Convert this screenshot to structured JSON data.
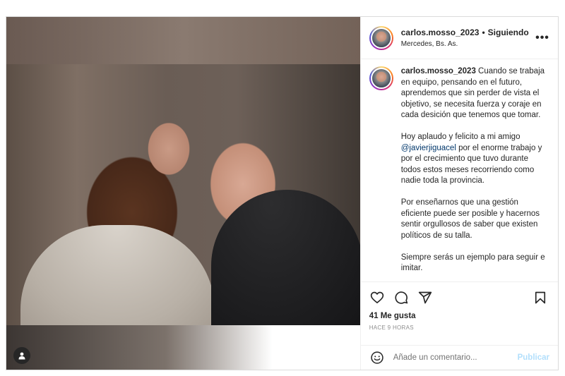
{
  "post": {
    "username": "carlos.mosso_2023",
    "separator": "•",
    "follow_status": "Siguiendo",
    "location": "Mercedes, Bs. As.",
    "more_label": "•••"
  },
  "caption": {
    "username": "carlos.mosso_2023",
    "p1": "Cuando se trabaja en equipo, pensando en el futuro, aprendemos que sin perder de vista el objetivo, se necesita fuerza y coraje en cada desición que tenemos que tomar.",
    "p2_before": "Hoy aplaudo y felicito a mi amigo ",
    "p2_mention": "@javierjiguacel",
    "p2_after": " por el enorme trabajo y por el crecimiento que tuvo durante todos estos meses recorriendo como nadie toda la provincia.",
    "p3": "Por enseñarnos que una gestión eficiente puede ser posible y hacernos sentir orgullosos de saber que existen políticos de su talla.",
    "p4": "Siempre serás un ejemplo para seguir e imitar."
  },
  "engagement": {
    "likes": "41 Me gusta",
    "time": "HACE 9 HORAS"
  },
  "comment": {
    "placeholder": "Añade un comentario...",
    "publish_label": "Publicar"
  },
  "icons": [
    "heart-icon",
    "comment-icon",
    "share-icon",
    "bookmark-icon",
    "emoji-icon",
    "user-tag-icon",
    "more-icon"
  ]
}
